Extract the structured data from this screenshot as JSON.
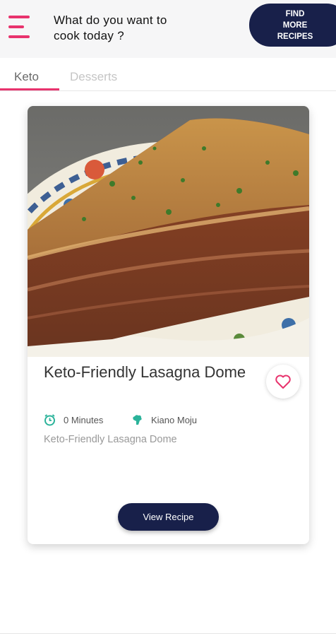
{
  "header": {
    "title": "What do you want to cook today ?",
    "find_button": "FIND\nMORE\nRECIPES"
  },
  "tabs": [
    {
      "label": "Keto",
      "active": true
    },
    {
      "label": "Desserts",
      "active": false
    }
  ],
  "recipe": {
    "title": "Keto-Friendly Lasagna Dome",
    "time": "0 Minutes",
    "author": "Kiano Moju",
    "description": "Keto-Friendly Lasagna Dome",
    "view_button": "View Recipe",
    "favorited": false
  },
  "colors": {
    "accent": "#e8336d",
    "navy": "#18204a",
    "icon_green": "#2bb39a"
  },
  "icons": [
    "menu-icon",
    "clock-icon",
    "chef-icon",
    "heart-icon"
  ]
}
